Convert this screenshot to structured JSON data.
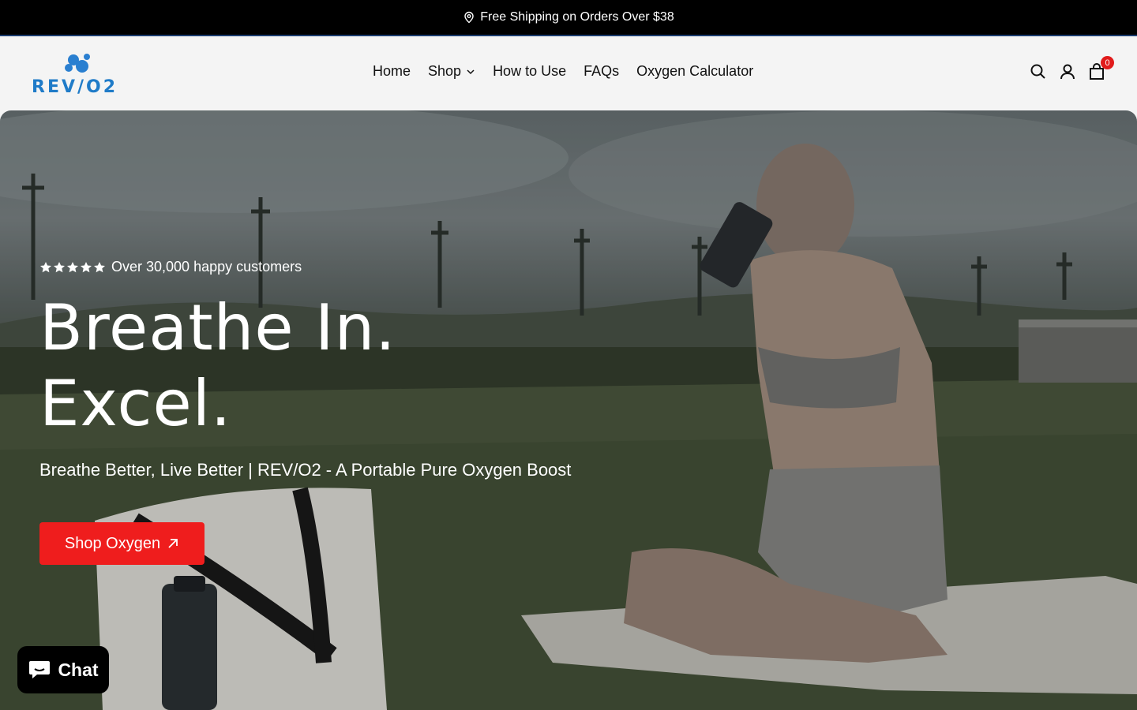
{
  "announcement": {
    "text": "Free Shipping on Orders Over $38",
    "icon": "location-pin-icon"
  },
  "brand": {
    "logo_text": "REV/O2",
    "logo_color": "#1f7bc8"
  },
  "nav": {
    "items": [
      {
        "label": "Home"
      },
      {
        "label": "Shop",
        "has_dropdown": true
      },
      {
        "label": "How to Use"
      },
      {
        "label": "FAQs"
      },
      {
        "label": "Oxygen Calculator"
      }
    ]
  },
  "header_icons": {
    "search": "search-icon",
    "account": "account-icon",
    "cart": "cart-icon",
    "cart_count": "0"
  },
  "hero": {
    "rating_stars": 5,
    "rating_text": "Over 30,000 happy customers",
    "headline_line1": "Breathe In.",
    "headline_line2": "Excel.",
    "subheadline": "Breathe Better, Live Better | REV/O2 - A Portable Pure Oxygen Boost",
    "cta_label": "Shop Oxygen",
    "cta_color": "#ef1d1d"
  },
  "chat": {
    "label": "Chat"
  }
}
